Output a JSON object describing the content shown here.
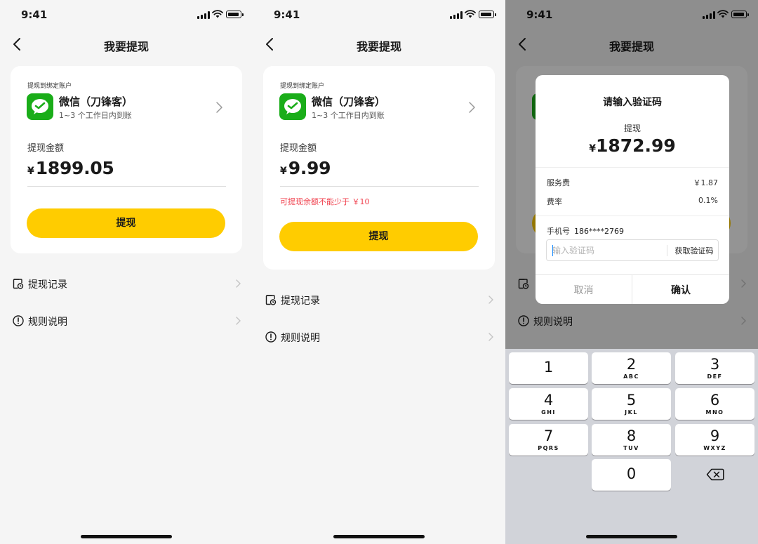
{
  "status_bar": {
    "time": "9:41"
  },
  "nav": {
    "title": "我要提现"
  },
  "account": {
    "hint": "提现到绑定账户",
    "name": "微信（刀锋客）",
    "arrival": "1~3 个工作日内到账"
  },
  "amount_label": "提现金额",
  "currency_symbol": "¥",
  "withdraw_button": "提现",
  "menu": {
    "records": "提现记录",
    "rules": "规则说明"
  },
  "screen1": {
    "amount": "1899.05"
  },
  "screen2": {
    "amount": "9.99",
    "warning": "可提现余额不能少于 ￥10"
  },
  "dialog": {
    "title": "请输入验证码",
    "subtitle": "提现",
    "amount": "1872.99",
    "fee_label": "服务费",
    "fee_value": "￥1.87",
    "rate_label": "费率",
    "rate_value": "0.1%",
    "phone_label": "手机号",
    "phone_value": "186****2769",
    "code_placeholder": "输入验证码",
    "get_code": "获取验证码",
    "cancel": "取消",
    "confirm": "确认"
  },
  "keypad": [
    {
      "num": "1",
      "letters": ""
    },
    {
      "num": "2",
      "letters": "ABC"
    },
    {
      "num": "3",
      "letters": "DEF"
    },
    {
      "num": "4",
      "letters": "GHI"
    },
    {
      "num": "5",
      "letters": "JKL"
    },
    {
      "num": "6",
      "letters": "MNO"
    },
    {
      "num": "7",
      "letters": "PQRS"
    },
    {
      "num": "8",
      "letters": "TUV"
    },
    {
      "num": "9",
      "letters": "WXYZ"
    },
    {
      "num": "0",
      "letters": ""
    }
  ],
  "colors": {
    "accent": "#FFCC00",
    "wechat_green": "#1AAD19",
    "warning": "#F0414E",
    "background": "#F5F5F5"
  },
  "icons": [
    "back-chevron-icon",
    "chevron-right-icon",
    "wechat-icon",
    "record-clock-icon",
    "info-circle-icon",
    "delete-backspace-icon",
    "signal-icon",
    "wifi-icon",
    "battery-icon"
  ]
}
